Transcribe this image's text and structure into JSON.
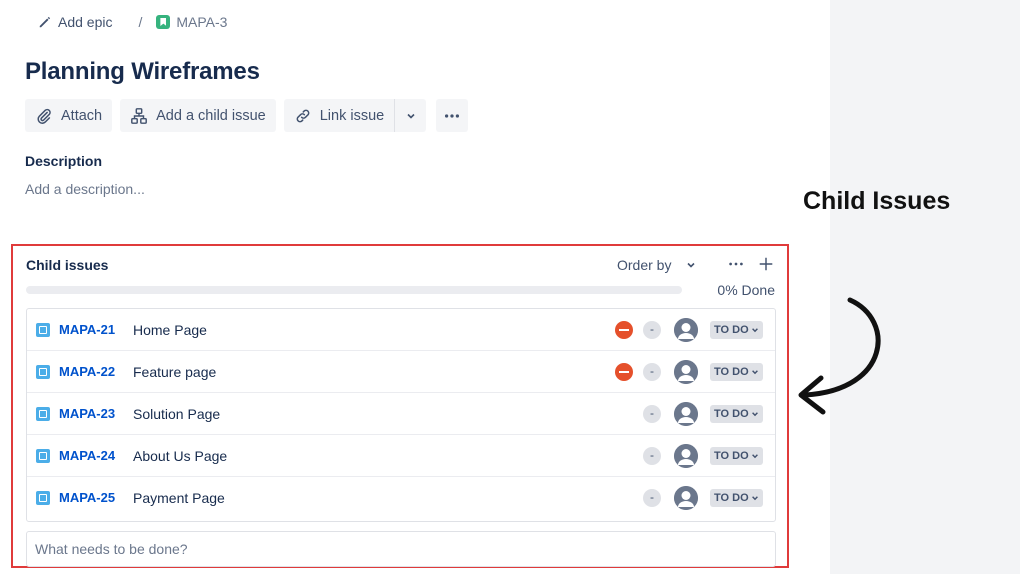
{
  "breadcrumb": {
    "add_epic_label": "Add epic",
    "separator": "/",
    "issue_key": "MAPA-3"
  },
  "issue": {
    "title": "Planning Wireframes"
  },
  "toolbar": {
    "attach_label": "Attach",
    "add_child_label": "Add a child issue",
    "link_issue_label": "Link issue"
  },
  "description": {
    "label": "Description",
    "placeholder": "Add a description..."
  },
  "child_issues": {
    "title": "Child issues",
    "order_by_label": "Order by",
    "progress_fraction": 0,
    "progress_label": "0% Done",
    "items": [
      {
        "key": "MAPA-21",
        "summary": "Home Page",
        "has_priority_icon": true,
        "estimate": "-",
        "status": "TO DO"
      },
      {
        "key": "MAPA-22",
        "summary": "Feature page",
        "has_priority_icon": true,
        "estimate": "-",
        "status": "TO DO"
      },
      {
        "key": "MAPA-23",
        "summary": "Solution Page",
        "has_priority_icon": false,
        "estimate": "-",
        "status": "TO DO"
      },
      {
        "key": "MAPA-24",
        "summary": "About Us Page",
        "has_priority_icon": false,
        "estimate": "-",
        "status": "TO DO"
      },
      {
        "key": "MAPA-25",
        "summary": "Payment Page",
        "has_priority_icon": false,
        "estimate": "-",
        "status": "TO DO"
      }
    ],
    "new_issue_placeholder": "What needs to be done?"
  },
  "annotation": {
    "text": "Child Issues"
  },
  "colors": {
    "highlight_border": "#e03b3b",
    "link_blue": "#0052cc",
    "epic_green": "#36b37e",
    "subtask_blue": "#4bade8",
    "priority_red": "#e5502b"
  },
  "icons": [
    "pencil-icon",
    "epic-icon",
    "paperclip-icon",
    "hierarchy-icon",
    "link-icon",
    "chevron-down-icon",
    "more-icon",
    "plus-icon",
    "subtask-icon",
    "priority-icon",
    "avatar-icon",
    "arrow-icon"
  ]
}
